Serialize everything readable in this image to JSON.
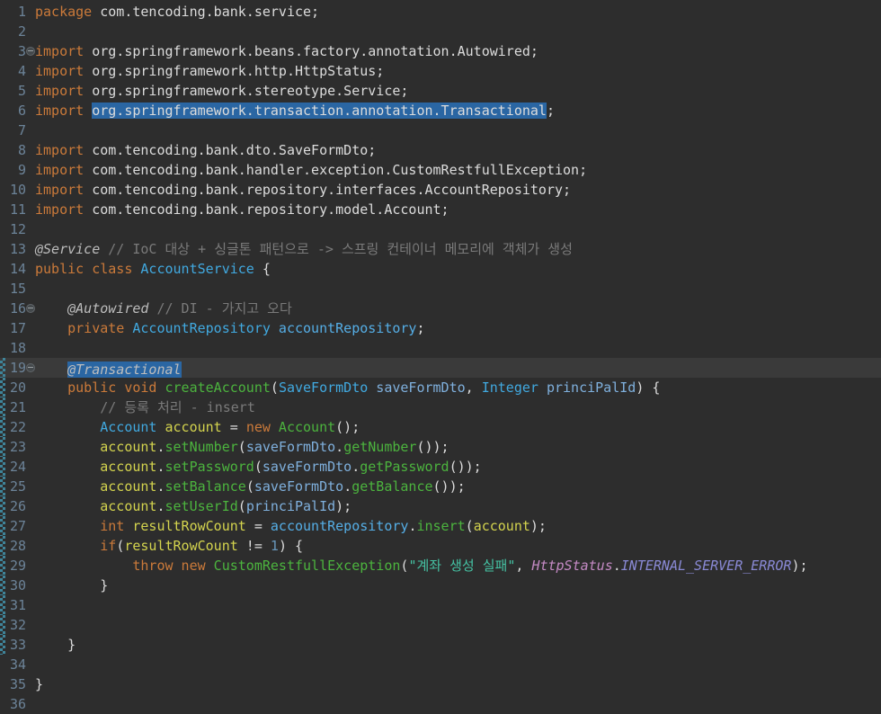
{
  "app": {
    "name": "java-code-editor",
    "file_language": "java"
  },
  "colors": {
    "background": "#2d2d2d",
    "current_line": "#3a3a3a",
    "selection": "#2a66a3",
    "line_number": "#6c8398",
    "change_bar": "#3f8499",
    "cursor": "#ffffff",
    "keyword": "#cb7a3a",
    "plain": "#dcdcdc",
    "type": "#41a9e0",
    "method": "#4cb43e",
    "variable": "#d4d44e",
    "parameter": "#7fb0dd",
    "field": "#55aee6",
    "number": "#6897bb",
    "string": "#45c3a4",
    "comment": "#7a7a7a",
    "annotation": "#bdbdbd",
    "static_reference": "#c48ac4",
    "constant": "#8a8ad6"
  },
  "editor": {
    "lines": [
      {
        "n": 1,
        "tokens": [
          [
            "kw",
            "package"
          ],
          [
            "plain",
            " com.tencoding.bank.service;"
          ]
        ]
      },
      {
        "n": 2,
        "tokens": []
      },
      {
        "n": 3,
        "fold": true,
        "tokens": [
          [
            "kw",
            "import"
          ],
          [
            "plain",
            " org.springframework.beans.factory.annotation.Autowired;"
          ]
        ]
      },
      {
        "n": 4,
        "tokens": [
          [
            "kw",
            "import"
          ],
          [
            "plain",
            " org.springframework.http.HttpStatus;"
          ]
        ]
      },
      {
        "n": 5,
        "tokens": [
          [
            "kw",
            "import"
          ],
          [
            "plain",
            " org.springframework.stereotype.Service;"
          ]
        ]
      },
      {
        "n": 6,
        "tokens": [
          [
            "kw",
            "import"
          ],
          [
            "plain",
            " "
          ],
          [
            "plain",
            "org.springframework.transaction.annotation.Transactional",
            true
          ],
          [
            "plain",
            ";"
          ]
        ]
      },
      {
        "n": 7,
        "tokens": []
      },
      {
        "n": 8,
        "tokens": [
          [
            "kw",
            "import"
          ],
          [
            "plain",
            " com.tencoding.bank.dto.SaveFormDto;"
          ]
        ]
      },
      {
        "n": 9,
        "tokens": [
          [
            "kw",
            "import"
          ],
          [
            "plain",
            " com.tencoding.bank.handler.exception.CustomRestfullException;"
          ]
        ]
      },
      {
        "n": 10,
        "tokens": [
          [
            "kw",
            "import"
          ],
          [
            "plain",
            " com.tencoding.bank.repository.interfaces.AccountRepository;"
          ]
        ]
      },
      {
        "n": 11,
        "tokens": [
          [
            "kw",
            "import"
          ],
          [
            "plain",
            " com.tencoding.bank.repository.model.Account;"
          ]
        ]
      },
      {
        "n": 12,
        "tokens": []
      },
      {
        "n": 13,
        "tokens": [
          [
            "annotation",
            "@Service"
          ],
          [
            "comment",
            " // IoC 대상 + 싱글톤 패턴으로 -> 스프링 컨테이너 메모리에 객체가 생성"
          ]
        ]
      },
      {
        "n": 14,
        "tokens": [
          [
            "kw",
            "public"
          ],
          [
            "plain",
            " "
          ],
          [
            "kw",
            "class"
          ],
          [
            "type",
            " AccountService"
          ],
          [
            "plain",
            " {"
          ]
        ]
      },
      {
        "n": 15,
        "tokens": []
      },
      {
        "n": 16,
        "fold": true,
        "tokens": [
          [
            "plain",
            "    "
          ],
          [
            "annotation",
            "@Autowired"
          ],
          [
            "comment",
            " // DI - 가지고 오다"
          ]
        ]
      },
      {
        "n": 17,
        "tokens": [
          [
            "plain",
            "    "
          ],
          [
            "kw",
            "private"
          ],
          [
            "type",
            " AccountRepository"
          ],
          [
            "field",
            " accountRepository"
          ],
          [
            "plain",
            ";"
          ]
        ]
      },
      {
        "n": 18,
        "tokens": []
      },
      {
        "n": 19,
        "fold": true,
        "changed": true,
        "current": true,
        "cursor": true,
        "tokens": [
          [
            "plain",
            "    "
          ],
          [
            "annotation",
            "@Transactional",
            true
          ]
        ]
      },
      {
        "n": 20,
        "changed": true,
        "tokens": [
          [
            "plain",
            "    "
          ],
          [
            "kw",
            "public"
          ],
          [
            "kw",
            " void"
          ],
          [
            "method",
            " createAccount"
          ],
          [
            "plain",
            "("
          ],
          [
            "type",
            "SaveFormDto"
          ],
          [
            "param",
            " saveFormDto"
          ],
          [
            "plain",
            ", "
          ],
          [
            "type",
            "Integer"
          ],
          [
            "param",
            " princiPalId"
          ],
          [
            "plain",
            ") {"
          ]
        ]
      },
      {
        "n": 21,
        "changed": true,
        "tokens": [
          [
            "plain",
            "        "
          ],
          [
            "comment",
            "// 등록 처리 - insert"
          ]
        ]
      },
      {
        "n": 22,
        "changed": true,
        "tokens": [
          [
            "plain",
            "        "
          ],
          [
            "type",
            "Account"
          ],
          [
            "var",
            " account"
          ],
          [
            "plain",
            " = "
          ],
          [
            "kw",
            "new"
          ],
          [
            "method",
            " Account"
          ],
          [
            "plain",
            "();"
          ]
        ]
      },
      {
        "n": 23,
        "changed": true,
        "tokens": [
          [
            "plain",
            "        "
          ],
          [
            "var",
            "account"
          ],
          [
            "plain",
            "."
          ],
          [
            "method",
            "setNumber"
          ],
          [
            "plain",
            "("
          ],
          [
            "param",
            "saveFormDto"
          ],
          [
            "plain",
            "."
          ],
          [
            "method",
            "getNumber"
          ],
          [
            "plain",
            "());"
          ]
        ]
      },
      {
        "n": 24,
        "changed": true,
        "tokens": [
          [
            "plain",
            "        "
          ],
          [
            "var",
            "account"
          ],
          [
            "plain",
            "."
          ],
          [
            "method",
            "setPassword"
          ],
          [
            "plain",
            "("
          ],
          [
            "param",
            "saveFormDto"
          ],
          [
            "plain",
            "."
          ],
          [
            "method",
            "getPassword"
          ],
          [
            "plain",
            "());"
          ]
        ]
      },
      {
        "n": 25,
        "changed": true,
        "tokens": [
          [
            "plain",
            "        "
          ],
          [
            "var",
            "account"
          ],
          [
            "plain",
            "."
          ],
          [
            "method",
            "setBalance"
          ],
          [
            "plain",
            "("
          ],
          [
            "param",
            "saveFormDto"
          ],
          [
            "plain",
            "."
          ],
          [
            "method",
            "getBalance"
          ],
          [
            "plain",
            "());"
          ]
        ]
      },
      {
        "n": 26,
        "changed": true,
        "tokens": [
          [
            "plain",
            "        "
          ],
          [
            "var",
            "account"
          ],
          [
            "plain",
            "."
          ],
          [
            "method",
            "setUserId"
          ],
          [
            "plain",
            "("
          ],
          [
            "param",
            "princiPalId"
          ],
          [
            "plain",
            ");"
          ]
        ]
      },
      {
        "n": 27,
        "changed": true,
        "tokens": [
          [
            "plain",
            "        "
          ],
          [
            "kw",
            "int"
          ],
          [
            "var",
            " resultRowCount"
          ],
          [
            "plain",
            " = "
          ],
          [
            "field",
            "accountRepository"
          ],
          [
            "plain",
            "."
          ],
          [
            "method",
            "insert"
          ],
          [
            "plain",
            "("
          ],
          [
            "var",
            "account"
          ],
          [
            "plain",
            ");"
          ]
        ]
      },
      {
        "n": 28,
        "changed": true,
        "tokens": [
          [
            "plain",
            "        "
          ],
          [
            "kw",
            "if"
          ],
          [
            "plain",
            "("
          ],
          [
            "var",
            "resultRowCount"
          ],
          [
            "plain",
            " != "
          ],
          [
            "num",
            "1"
          ],
          [
            "plain",
            ") {"
          ]
        ]
      },
      {
        "n": 29,
        "changed": true,
        "tokens": [
          [
            "plain",
            "            "
          ],
          [
            "kw",
            "throw"
          ],
          [
            "kw",
            " new"
          ],
          [
            "method",
            " CustomRestfullException"
          ],
          [
            "plain",
            "("
          ],
          [
            "str",
            "\"계좌 생성 실패\""
          ],
          [
            "plain",
            ", "
          ],
          [
            "staticref",
            "HttpStatus"
          ],
          [
            "plain",
            "."
          ],
          [
            "constant",
            "INTERNAL_SERVER_ERROR"
          ],
          [
            "plain",
            ");"
          ]
        ]
      },
      {
        "n": 30,
        "changed": true,
        "tokens": [
          [
            "plain",
            "        }"
          ]
        ]
      },
      {
        "n": 31,
        "changed": true,
        "tokens": []
      },
      {
        "n": 32,
        "changed": true,
        "tokens": []
      },
      {
        "n": 33,
        "changed": true,
        "tokens": [
          [
            "plain",
            "    }"
          ]
        ]
      },
      {
        "n": 34,
        "tokens": []
      },
      {
        "n": 35,
        "tokens": [
          [
            "plain",
            "}"
          ]
        ]
      },
      {
        "n": 36,
        "tokens": []
      }
    ]
  }
}
